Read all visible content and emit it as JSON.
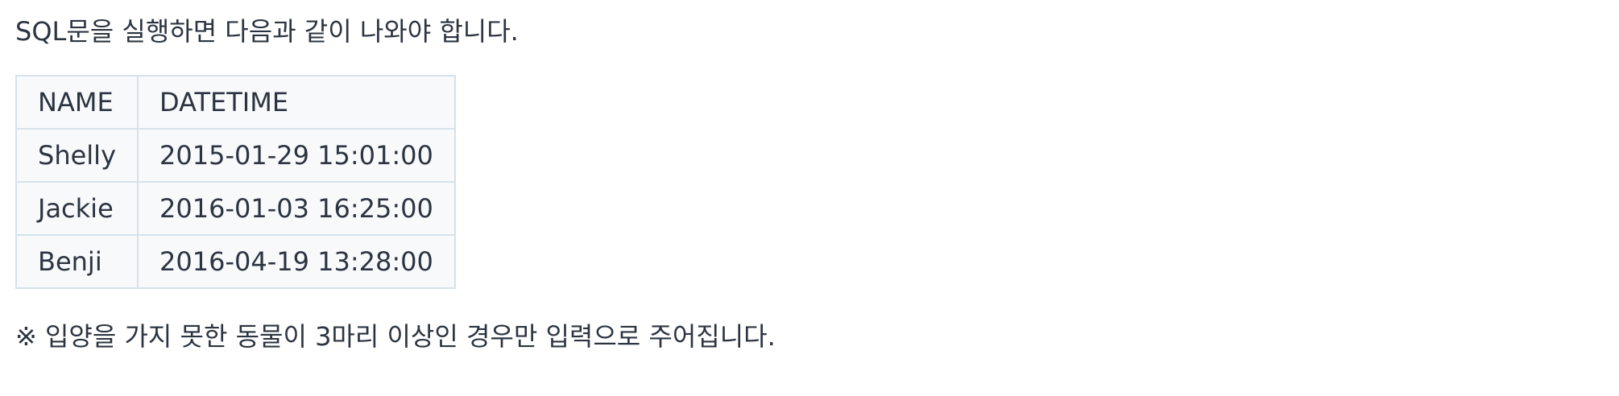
{
  "intro_text": "SQL문을 실행하면 다음과 같이 나와야 합니다.",
  "table": {
    "headers": [
      "NAME",
      "DATETIME"
    ],
    "rows": [
      [
        "Shelly",
        "2015-01-29 15:01:00"
      ],
      [
        "Jackie",
        "2016-01-03 16:25:00"
      ],
      [
        "Benji",
        "2016-04-19 13:28:00"
      ]
    ]
  },
  "note_text": "※ 입양을 가지 못한 동물이 3마리 이상인 경우만 입력으로 주어집니다."
}
